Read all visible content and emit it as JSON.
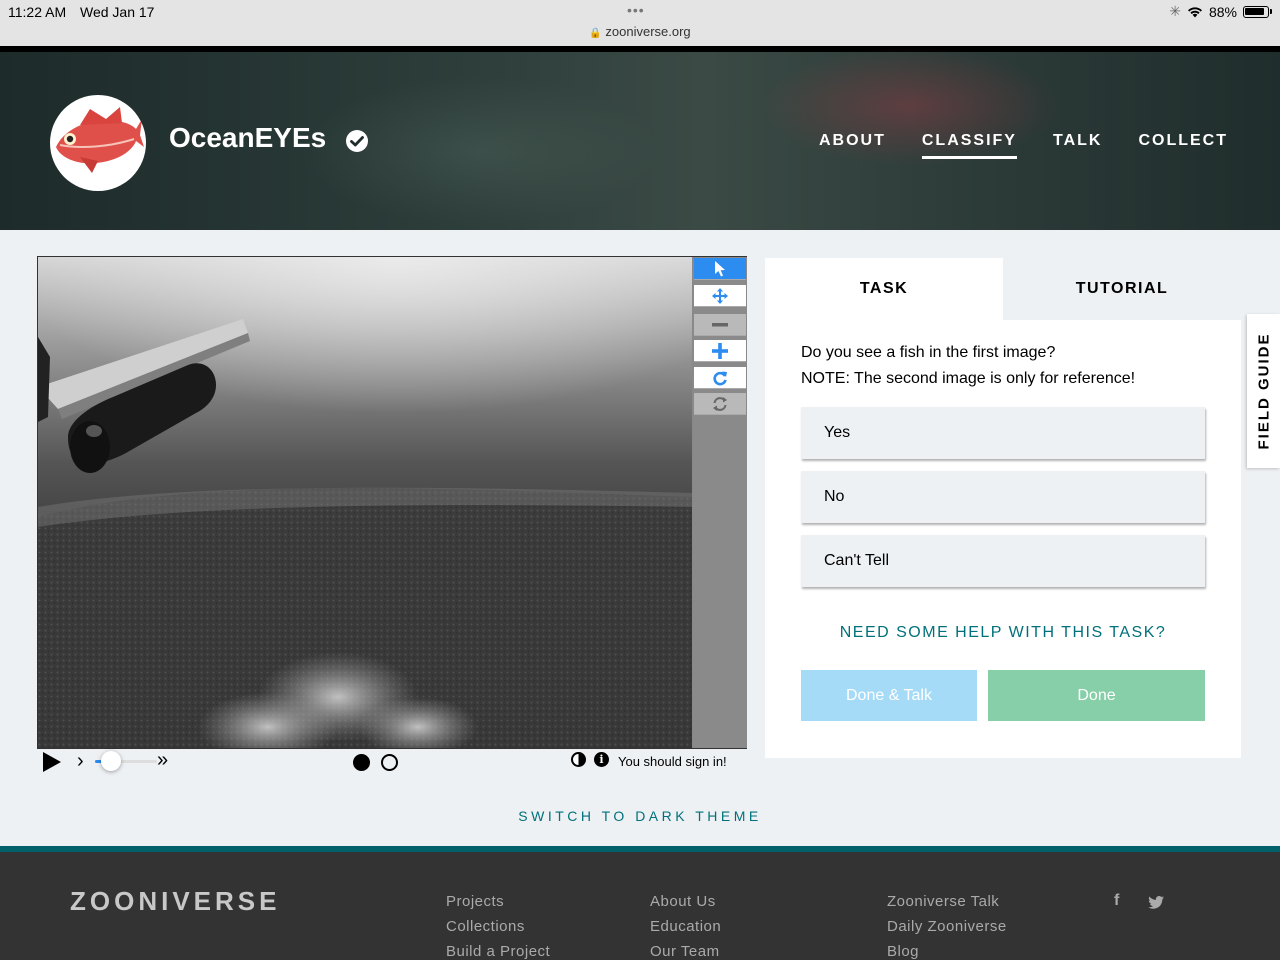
{
  "status_bar": {
    "time": "11:22 AM",
    "date": "Wed Jan 17",
    "url": "zooniverse.org",
    "battery": "88%"
  },
  "header": {
    "project_title": "OceanEYEs",
    "nav": [
      {
        "label": "ABOUT",
        "active": false
      },
      {
        "label": "CLASSIFY",
        "active": true
      },
      {
        "label": "TALK",
        "active": false
      },
      {
        "label": "COLLECT",
        "active": false
      }
    ]
  },
  "viewer": {
    "tools": [
      "pointer-icon",
      "move-icon",
      "zoom-out-icon",
      "zoom-in-icon",
      "rotate-icon",
      "reset-icon"
    ],
    "playback_speed": 0.25,
    "frames": 2,
    "current_frame": 1,
    "sign_in_message": "You should sign in!"
  },
  "task": {
    "tabs": {
      "task": "TASK",
      "tutorial": "TUTORIAL"
    },
    "question_line1": "Do you see a fish in the first image?",
    "question_line2": "NOTE: The second image is only for reference!",
    "answers": [
      "Yes",
      "No",
      "Can't Tell"
    ],
    "help_link": "NEED SOME HELP WITH THIS TASK?",
    "done_talk_label": "Done & Talk",
    "done_label": "Done"
  },
  "field_guide_label": "FIELD GUIDE",
  "theme_toggle": "SWITCH TO DARK THEME",
  "footer": {
    "logo": "ZOONIVERSE",
    "col1": [
      "Projects",
      "Collections",
      "Build a Project"
    ],
    "col2": [
      "About Us",
      "Education",
      "Our Team"
    ],
    "col3": [
      "Zooniverse Talk",
      "Daily Zooniverse",
      "Blog"
    ],
    "social": [
      "facebook-icon",
      "twitter-icon"
    ]
  }
}
